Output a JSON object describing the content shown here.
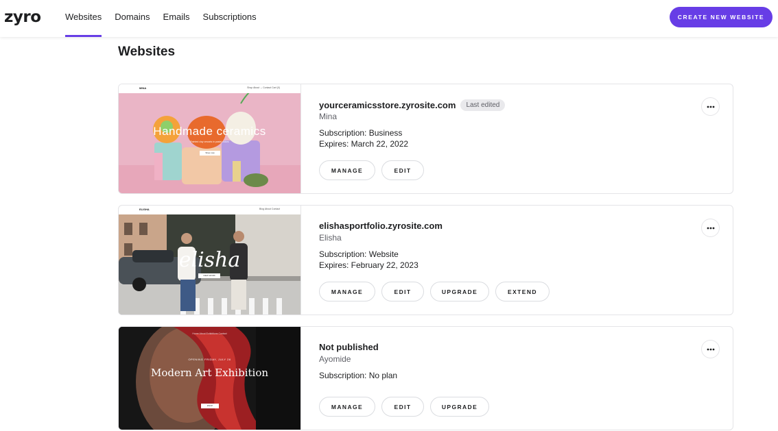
{
  "header": {
    "logo": "zyro",
    "nav": [
      "Websites",
      "Domains",
      "Emails",
      "Subscriptions"
    ],
    "active_nav": "Websites",
    "create_button": "CREATE NEW WEBSITE",
    "accent_color": "#673de6"
  },
  "page": {
    "title": "Websites"
  },
  "sites": [
    {
      "domain": "yourceramicsstore.zyrosite.com",
      "badge": "Last edited",
      "owner": "Mina",
      "subscription": "Subscription: Business",
      "expires": "Expires: March 22, 2022",
      "buttons": [
        "MANAGE",
        "EDIT"
      ],
      "thumbnail": {
        "brand": "MINA",
        "links": "Shop   About ⌄   Contact   Cart (0)",
        "hero_title": "Handmade ceramics",
        "hero_subtitle": "Painted clay vessels in pastel colors",
        "hero_button": "Shop now"
      }
    },
    {
      "domain": "elishasportfolio.zyrosite.com",
      "owner": "Elisha",
      "subscription": "Subscription: Website",
      "expires": "Expires: February 22, 2023",
      "buttons": [
        "MANAGE",
        "EDIT",
        "UPGRADE",
        "EXTEND"
      ],
      "thumbnail": {
        "brand": "ELISHA",
        "links": "Blog   About   Contact",
        "hero_title": "elisha",
        "hero_button": "VIEW WORK"
      }
    },
    {
      "domain": "Not published",
      "owner": "Ayomide",
      "subscription": "Subscription: No plan",
      "buttons": [
        "MANAGE",
        "EDIT",
        "UPGRADE"
      ],
      "thumbnail": {
        "links": "Home   About   Exhibitions   Contact",
        "hero_kicker": "OPENING FRIDAY, JULY 26",
        "hero_title": "Modern Art Exhibition",
        "hero_button": "RSVP"
      }
    }
  ]
}
